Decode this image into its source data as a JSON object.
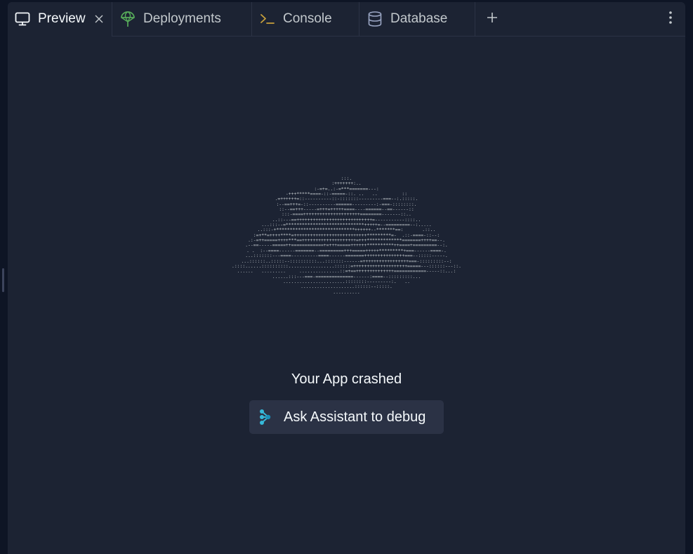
{
  "tabs": [
    {
      "label": "Preview",
      "icon": "monitor-icon",
      "active": true,
      "closable": true
    },
    {
      "label": "Deployments",
      "icon": "deployments-icon",
      "active": false
    },
    {
      "label": "Console",
      "icon": "terminal-icon",
      "active": false
    },
    {
      "label": "Database",
      "icon": "database-icon",
      "active": false
    }
  ],
  "add_tab_icon": "plus-icon",
  "menu_icon": "kebab-menu-icon",
  "crash": {
    "ascii_art": [
      ":::.",
      ":+++++++:..",
      ":-=+=..:-=***=======---:",
      "-+++*****====-::-=====-::. ..   ..         ::",
      ".=++++++=::----------::-:::::::---------===--:.:::::.",
      ":--==+++=-::----------======---------:-===-::::::::.",
      "::--==+++-----=+++=+++++====----======--==------::",
      ":::-====+++++++++++++++++++++========-------::..",
      "..::---==++++++++++++++++++++++++++++=-----------::::..",
      "...:::--=*****************************+++++=--=========--:.....",
      "..:::-+*****************************++++++--*******==:       .::..",
      ":=+**=++++****=+++++++++++++++++++++++++++*********=-  .::-====-::--:",
      ".:-=++=====++++***==++++++++++++++++++++=+++*************=======++++==--.",
      ".--==-----=====++============+=+++=====++++++**********++====+=========--:.",
      ". .  :--====------=======--=========+++=====+++++*********+===------====-.",
      "...:::::::---====----------====------=======+++++++++++++++===--:::::-----.",
      "...::::::..:::::--::::::::::...:::::::------=+++++++++++++++++===-:::::::::--:",
      ".::::......::::::::::.................::::::=++++++++++++++++++++=====---::::::---::.",
      "......   .........     ...............::=+==++++++++++++++============-----::...:",
      "......:::---===-==============------:====--:::::::::...",
      ".......................::::::::---------:.   ..",
      "....................::::::--:::::.",
      ".........."
    ],
    "title": "Your App crashed",
    "debug_button_label": "Ask Assistant to debug",
    "debug_button_icon": "assistant-icon"
  },
  "colors": {
    "background": "#1c2333",
    "outer": "#0e1525",
    "button_bg": "#2b3245",
    "text": "#f5f9fc",
    "muted_text": "#c2c8cc",
    "deployments_icon": "#57ab5a",
    "console_icon": "#c7a03c",
    "database_icon": "#9aa6c4",
    "assistant_icon": "#36b9d9"
  }
}
